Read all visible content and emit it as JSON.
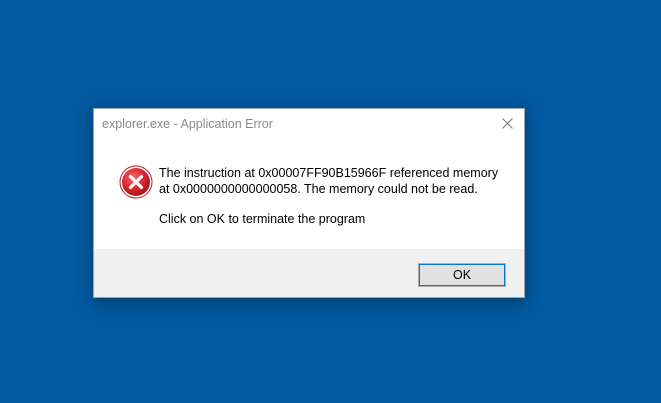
{
  "desktop": {
    "background_color": "#025aa0"
  },
  "dialog": {
    "title": "explorer.exe - Application Error",
    "close_icon": "close-icon",
    "error_icon": "error-x-icon",
    "message_line1": "The instruction at 0x00007FF90B15966F referenced memory at 0x0000000000000058. The memory could not be read.",
    "message_line2": "Click on OK to terminate the program",
    "ok_label": "OK",
    "colors": {
      "error_red": "#d9272e",
      "footer_gray": "#f0f0f0",
      "accent_blue": "#0078d7"
    }
  }
}
